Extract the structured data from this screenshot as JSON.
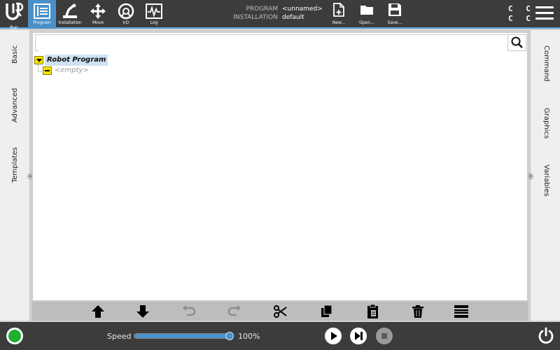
{
  "topbar": {
    "logo_icon": "ur-logo",
    "buttons": [
      {
        "label": "Run",
        "icon": "run-icon",
        "active": false
      },
      {
        "label": "Program",
        "icon": "program-icon",
        "active": true
      },
      {
        "label": "Installation",
        "icon": "installation-icon",
        "active": false
      },
      {
        "label": "Move",
        "icon": "move-icon",
        "active": false
      },
      {
        "label": "I/O",
        "icon": "io-icon",
        "active": false
      },
      {
        "label": "Log",
        "icon": "log-icon",
        "active": false
      }
    ],
    "program_key": "PROGRAM",
    "program_value": "<unnamed>",
    "installation_key": "INSTALLATION",
    "installation_value": "default",
    "file_buttons": [
      {
        "label": "New...",
        "icon": "new-file-icon"
      },
      {
        "label": "Open...",
        "icon": "folder-icon"
      },
      {
        "label": "Save...",
        "icon": "save-icon"
      }
    ],
    "cc_row1": "C C",
    "cc_row2": "C C",
    "accent_color": "#4a90c8"
  },
  "left_tabs": [
    "Basic",
    "Advanced",
    "Templates"
  ],
  "right_tabs": [
    "Command",
    "Graphics",
    "Variables"
  ],
  "search": {
    "placeholder": "",
    "value": ""
  },
  "tree": {
    "root_label": "Robot Program",
    "child_label": "<empty>"
  },
  "toolbar_icons": [
    "move-up-icon",
    "move-down-icon",
    "undo-icon",
    "redo-icon",
    "cut-icon",
    "copy-icon",
    "paste-icon",
    "delete-icon",
    "suppress-icon"
  ],
  "bottombar": {
    "status_color": "#1db02a",
    "speed_label": "Speed",
    "speed_value": "100%",
    "speed_fraction": 1.0,
    "play_icon": "play-icon",
    "step_icon": "step-icon",
    "stop_icon": "stop-icon",
    "power_icon": "power-icon"
  }
}
